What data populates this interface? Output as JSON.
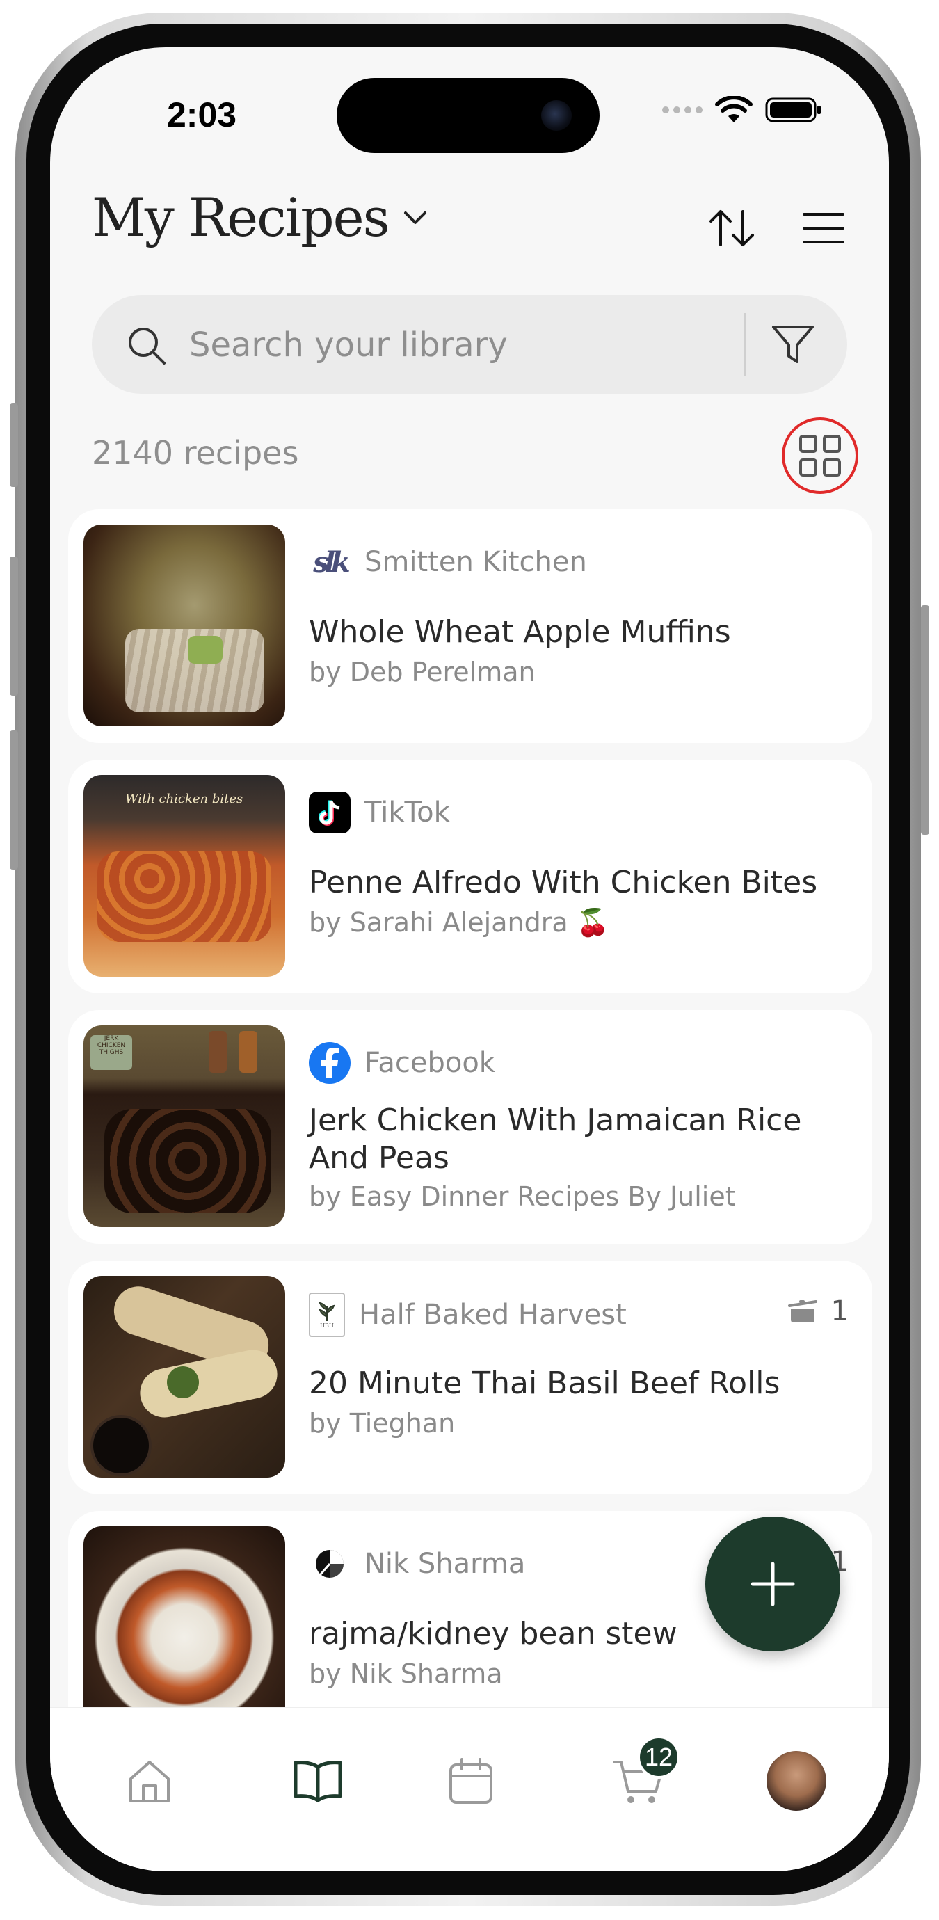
{
  "status_bar": {
    "time": "2:03"
  },
  "header": {
    "title": "My Recipes"
  },
  "search": {
    "placeholder": "Search your library"
  },
  "library": {
    "count_text": "2140 recipes"
  },
  "recipes": [
    {
      "source": "Smitten Kitchen",
      "title": "Whole Wheat Apple Muffins",
      "author": "by Deb Perelman",
      "source_logo_text": "slk",
      "thumb_colors": [
        "#3b2414",
        "#7a6a3c",
        "#a49a70"
      ]
    },
    {
      "source": "TikTok",
      "title": "Penne Alfredo With Chicken Bites",
      "author": "by Sarahi Alejandra 🍒",
      "thumb_colors": [
        "#2d2a2a",
        "#c15a2a",
        "#e8b070"
      ],
      "thumb_caption": "With chicken bites"
    },
    {
      "source": "Facebook",
      "title": "Jerk Chicken With Jamaican Rice And Peas",
      "author": "by Easy Dinner Recipes By Juliet",
      "thumb_colors": [
        "#3a2a1e",
        "#2a1a12",
        "#6a5a3a"
      ],
      "thumb_caption": "JERK CHICKEN THIGHS"
    },
    {
      "source": "Half Baked Harvest",
      "title": "20 Minute Thai Basil Beef Rolls",
      "author": "by Tieghan",
      "cook_count": "1",
      "source_logo_text": "HBH",
      "thumb_colors": [
        "#2a1e14",
        "#d8c49a",
        "#4a6a2a"
      ]
    },
    {
      "source": "Nik Sharma",
      "title": "rajma/kidney bean stew",
      "author": "by Nik Sharma",
      "cook_count": "1",
      "thumb_colors": [
        "#3a2418",
        "#c05a2a",
        "#f2efe8"
      ]
    }
  ],
  "tabbar": {
    "cart_badge": "12"
  },
  "icons": [
    "search-icon",
    "filter-icon",
    "sort-icon",
    "menu-icon",
    "grid-view-icon",
    "chevron-down-icon",
    "add-icon",
    "home-icon",
    "book-icon",
    "calendar-icon",
    "cart-icon",
    "cookware-icon"
  ],
  "colors": {
    "accent": "#1d3b2c",
    "highlight_ring": "#e02a2a"
  }
}
